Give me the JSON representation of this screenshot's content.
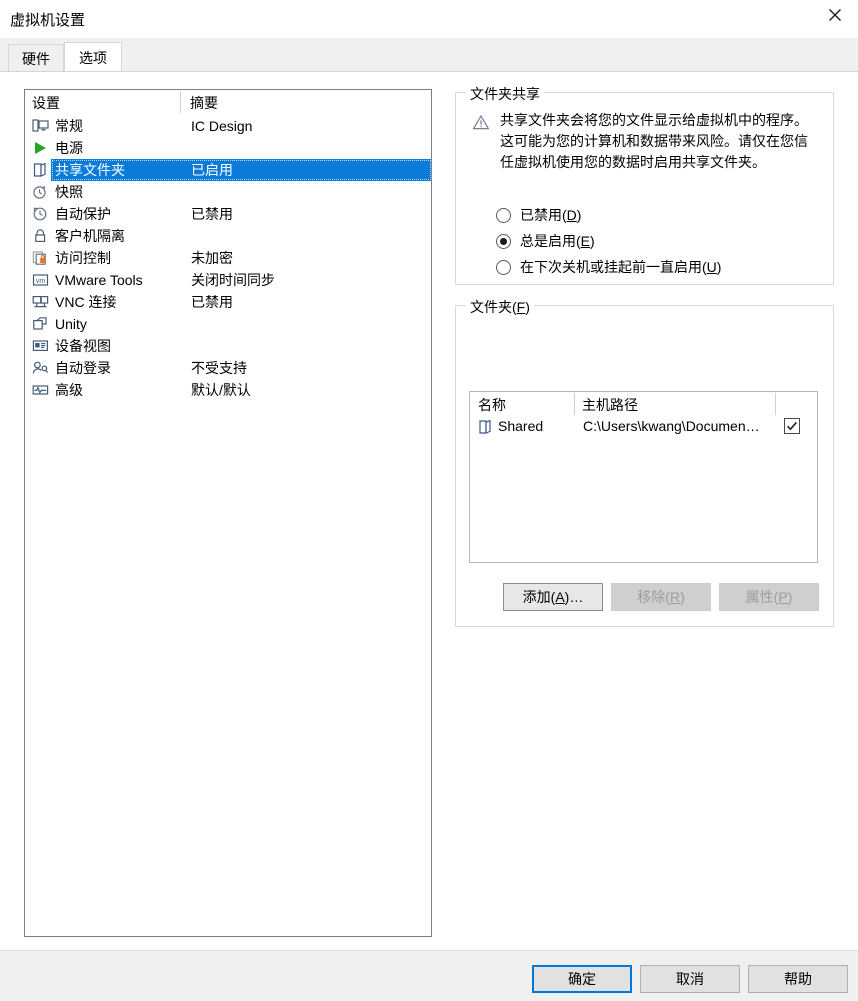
{
  "window": {
    "title": "虚拟机设置",
    "close_icon": "close-icon"
  },
  "tabs": [
    {
      "label": "硬件",
      "active": false
    },
    {
      "label": "选项",
      "active": true
    }
  ],
  "settings_list": {
    "headers": {
      "setting": "设置",
      "summary": "摘要"
    },
    "rows": [
      {
        "icon": "monitor-icon",
        "label": "常规",
        "summary": "IC Design",
        "selected": false
      },
      {
        "icon": "power-play-icon",
        "label": "电源",
        "summary": "",
        "selected": false
      },
      {
        "icon": "shared-folder-icon",
        "label": "共享文件夹",
        "summary": "已启用",
        "selected": true
      },
      {
        "icon": "snapshot-clock-icon",
        "label": "快照",
        "summary": "",
        "selected": false
      },
      {
        "icon": "autoprotect-icon",
        "label": "自动保护",
        "summary": "已禁用",
        "selected": false
      },
      {
        "icon": "lock-icon",
        "label": "客户机隔离",
        "summary": "",
        "selected": false
      },
      {
        "icon": "access-control-icon",
        "label": "访问控制",
        "summary": "未加密",
        "selected": false
      },
      {
        "icon": "vmware-tools-icon",
        "label": "VMware Tools",
        "summary": "关闭时间同步",
        "selected": false
      },
      {
        "icon": "vnc-icon",
        "label": "VNC 连接",
        "summary": "已禁用",
        "selected": false
      },
      {
        "icon": "unity-icon",
        "label": "Unity",
        "summary": "",
        "selected": false
      },
      {
        "icon": "device-view-icon",
        "label": "设备视图",
        "summary": "",
        "selected": false
      },
      {
        "icon": "auto-login-icon",
        "label": "自动登录",
        "summary": "不受支持",
        "selected": false
      },
      {
        "icon": "advanced-icon",
        "label": "高级",
        "summary": "默认/默认",
        "selected": false
      }
    ]
  },
  "folder_sharing": {
    "legend": "文件夹共享",
    "warning_icon": "warning-triangle-icon",
    "warning_text": "共享文件夹会将您的文件显示给虚拟机中的程序。这可能为您的计算机和数据带来风险。请仅在您信任虚拟机使用您的数据时启用共享文件夹。",
    "options": [
      {
        "label": "已禁用(",
        "accel": "D",
        "label_end": ")",
        "selected": false
      },
      {
        "label": "总是启用(",
        "accel": "E",
        "label_end": ")",
        "selected": true
      },
      {
        "label": "在下次关机或挂起前一直启用(",
        "accel": "U",
        "label_end": ")",
        "selected": false
      }
    ]
  },
  "folders": {
    "legend_start": "文件夹(",
    "legend_accel": "F",
    "legend_end": ")",
    "headers": {
      "name": "名称",
      "path": "主机路径"
    },
    "rows": [
      {
        "icon": "shared-folder-icon",
        "name": "Shared",
        "path": "C:\\Users\\kwang\\Documen…",
        "enabled": true
      }
    ],
    "buttons": [
      {
        "label_start": "添加(",
        "accel": "A",
        "label_end": ")…",
        "enabled": true
      },
      {
        "label_start": "移除(",
        "accel": "R",
        "label_end": ")",
        "enabled": false
      },
      {
        "label_start": "属性(",
        "accel": "P",
        "label_end": ")",
        "enabled": false
      }
    ]
  },
  "footer": {
    "ok": "确定",
    "cancel": "取消",
    "help": "帮助"
  },
  "colors": {
    "selection_blue": "#0a7bd8",
    "focus_blue": "#0078d7",
    "dialog_bg": "#ffffff",
    "footer_bg": "#f0f0f0",
    "lock_orange": "#f07020"
  }
}
